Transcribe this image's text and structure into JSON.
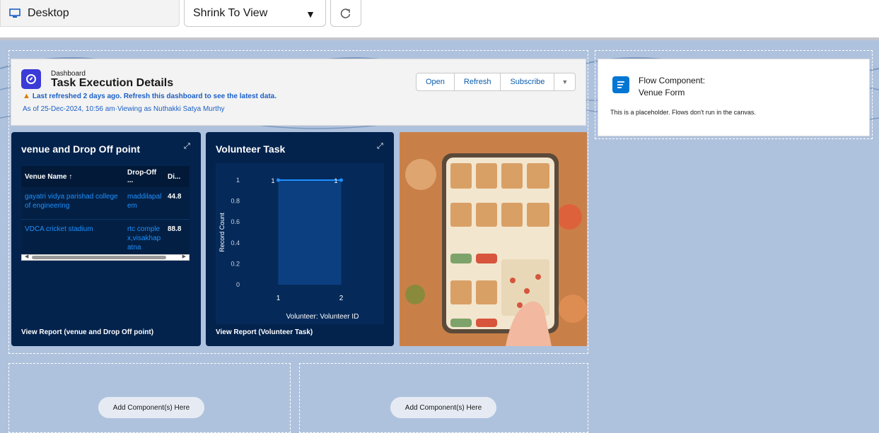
{
  "toolbar": {
    "device_label": "Desktop",
    "view_select_value": "Shrink To View"
  },
  "dashboard_header": {
    "label": "Dashboard",
    "title": "Task Execution Details",
    "warning": "Last refreshed 2 days ago. Refresh this dashboard to see the latest data.",
    "as_of": "As of 25-Dec-2024, 10:56 am·Viewing as Nuthakki Satya Murthy",
    "buttons": {
      "open": "Open",
      "refresh": "Refresh",
      "subscribe": "Subscribe"
    }
  },
  "venue_card": {
    "title": "venue and Drop Off point",
    "columns": [
      "Venue Name ↑",
      "Drop-Off ...",
      "Di..."
    ],
    "rows": [
      {
        "venue": "gayatri vidya parishad college of engineering",
        "drop_off": "maddilapalem",
        "distance": "44.8"
      },
      {
        "venue": "VDCA cricket stadium",
        "drop_off": "rtc complex,visakhapatna",
        "distance": "88.8"
      }
    ],
    "footer": "View Report (venue and Drop Off point)"
  },
  "volunteer_card": {
    "title": "Volunteer Task",
    "footer": "View Report (Volunteer Task)"
  },
  "chart_data": {
    "type": "line",
    "x": [
      "1",
      "2"
    ],
    "series": [
      {
        "values": [
          1,
          1
        ]
      }
    ],
    "xlabel": "Volunteer: Volunteer ID",
    "ylabel": "Record Count",
    "ylim": [
      0,
      1
    ],
    "yticks": [
      "0",
      "0.2",
      "0.4",
      "0.6",
      "0.8",
      "1"
    ],
    "data_labels": [
      "1",
      "1"
    ],
    "grid": false
  },
  "flow_card": {
    "title_line1": "Flow Component:",
    "title_line2": "Venue Form",
    "body": "This is a placeholder. Flows don't run in the canvas."
  },
  "placeholders": {
    "left": "Add Component(s) Here",
    "right": "Add Component(s) Here"
  },
  "colors": {
    "canvas_bg": "#afc2dd",
    "widget_bg": "#03234d",
    "link_blue": "#1b5fc5",
    "chart_line": "#1e90ff",
    "dashboard_icon": "#3b3bd8",
    "flow_icon": "#0176d3"
  }
}
